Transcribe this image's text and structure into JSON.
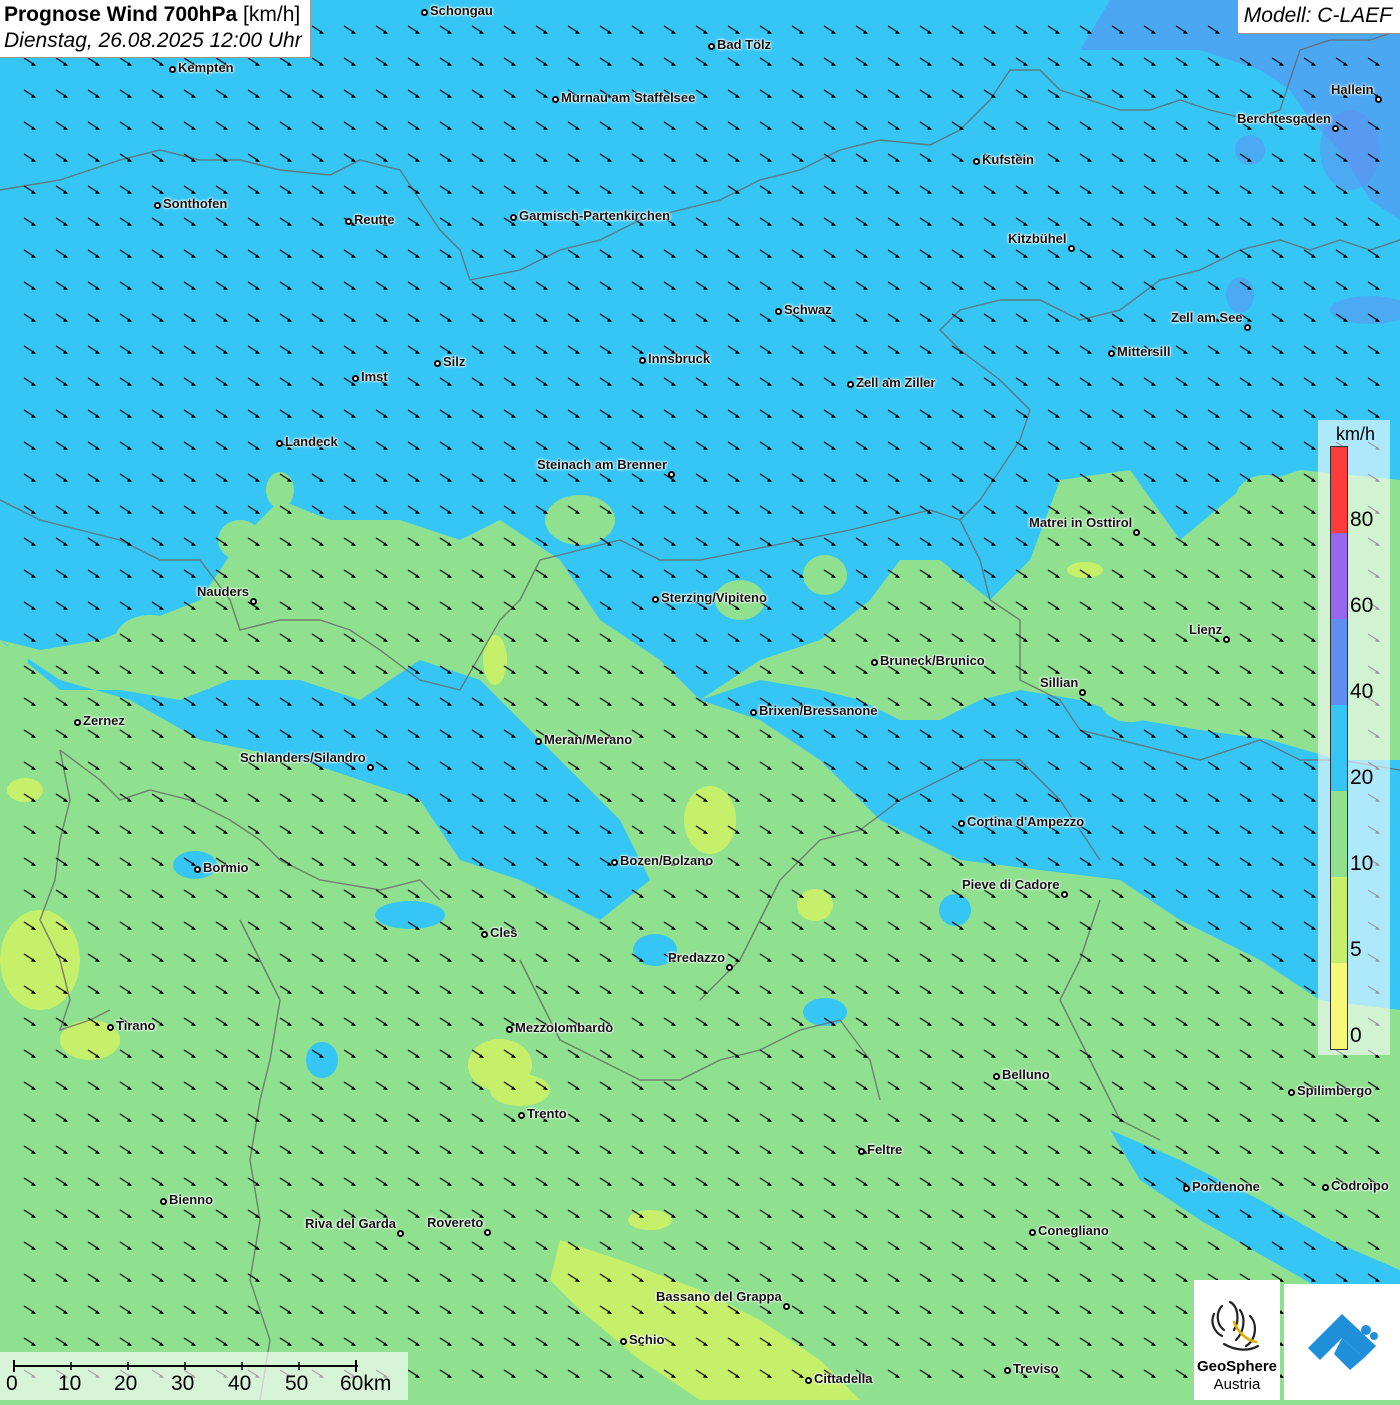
{
  "header": {
    "title_bold": "Prognose Wind 700hPa",
    "title_unit": "[km/h]",
    "subtitle": "Dienstag, 26.08.2025 12:00 Uhr"
  },
  "model": "Modell: C-LAEF",
  "legend": {
    "unit": "km/h",
    "labels": [
      "80",
      "60",
      "40",
      "20",
      "10",
      "5",
      "0"
    ],
    "colors": [
      "#ff3b3b",
      "#9966ee",
      "#5f8ef0",
      "#36c6f5",
      "#8fe08f",
      "#c6f06a",
      "#f8f878"
    ]
  },
  "scalebar": {
    "labels": [
      "0",
      "10",
      "20",
      "30",
      "40",
      "50",
      "60km"
    ]
  },
  "logo": {
    "name_line1": "GeoSphere",
    "name_line2": "Austria"
  },
  "cities": [
    {
      "name": "Schongau"
    },
    {
      "name": "Bad Tölz"
    },
    {
      "name": "Kempten"
    },
    {
      "name": "Murnau am Staffelsee"
    },
    {
      "name": "Hallein"
    },
    {
      "name": "Berchtesgaden"
    },
    {
      "name": "Kufstein"
    },
    {
      "name": "Sonthofen"
    },
    {
      "name": "Reutte"
    },
    {
      "name": "Garmisch-Partenkirchen"
    },
    {
      "name": "Kitzbühel"
    },
    {
      "name": "Schwaz"
    },
    {
      "name": "Zell am See"
    },
    {
      "name": "Mittersill"
    },
    {
      "name": "Silz"
    },
    {
      "name": "Innsbruck"
    },
    {
      "name": "Imst"
    },
    {
      "name": "Zell am Ziller"
    },
    {
      "name": "Landeck"
    },
    {
      "name": "Steinach am Brenner"
    },
    {
      "name": "Matrei in Osttirol"
    },
    {
      "name": "Nauders"
    },
    {
      "name": "Sterzing/Vipiteno"
    },
    {
      "name": "Lienz"
    },
    {
      "name": "Bruneck/Brunico"
    },
    {
      "name": "Sillian"
    },
    {
      "name": "Brixen/Bressanone"
    },
    {
      "name": "Zernez"
    },
    {
      "name": "Meran/Merano"
    },
    {
      "name": "Schlanders/Silandro"
    },
    {
      "name": "Cortina d'Ampezzo"
    },
    {
      "name": "Bozen/Bolzano"
    },
    {
      "name": "Bormio"
    },
    {
      "name": "Pieve di Cadore"
    },
    {
      "name": "Cles"
    },
    {
      "name": "Predazzo"
    },
    {
      "name": "Tirano"
    },
    {
      "name": "Mezzolombardo"
    },
    {
      "name": "Belluno"
    },
    {
      "name": "Spilimbergo"
    },
    {
      "name": "Trento"
    },
    {
      "name": "Feltre"
    },
    {
      "name": "Pordenone"
    },
    {
      "name": "Codroipo"
    },
    {
      "name": "Bienno"
    },
    {
      "name": "Riva del Garda"
    },
    {
      "name": "Rovereto"
    },
    {
      "name": "Conegliano"
    },
    {
      "name": "Bassano del Grappa"
    },
    {
      "name": "Schio"
    },
    {
      "name": "Treviso"
    },
    {
      "name": "Cittadella"
    }
  ]
}
